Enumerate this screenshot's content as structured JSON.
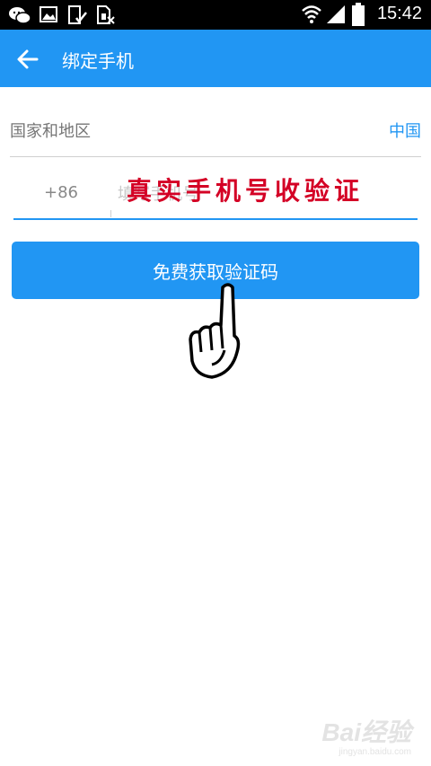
{
  "status_bar": {
    "time": "15:42",
    "icons": [
      "wechat-icon",
      "gallery-icon",
      "phone-check-icon",
      "sim-icon",
      "wifi-icon",
      "signal-icon",
      "battery-icon"
    ]
  },
  "app_bar": {
    "title": "绑定手机",
    "color": "#2196f3"
  },
  "region": {
    "label": "国家和地区",
    "value": "中国"
  },
  "phone": {
    "country_code": "+86",
    "placeholder": "填写手机号",
    "value": ""
  },
  "annotation": {
    "text": "真实手机号收验证",
    "color": "#d40025"
  },
  "send_button": {
    "label": "免费获取验证码"
  },
  "watermark": {
    "logo": "Bai经验",
    "url": "jingyan.baidu.com"
  }
}
